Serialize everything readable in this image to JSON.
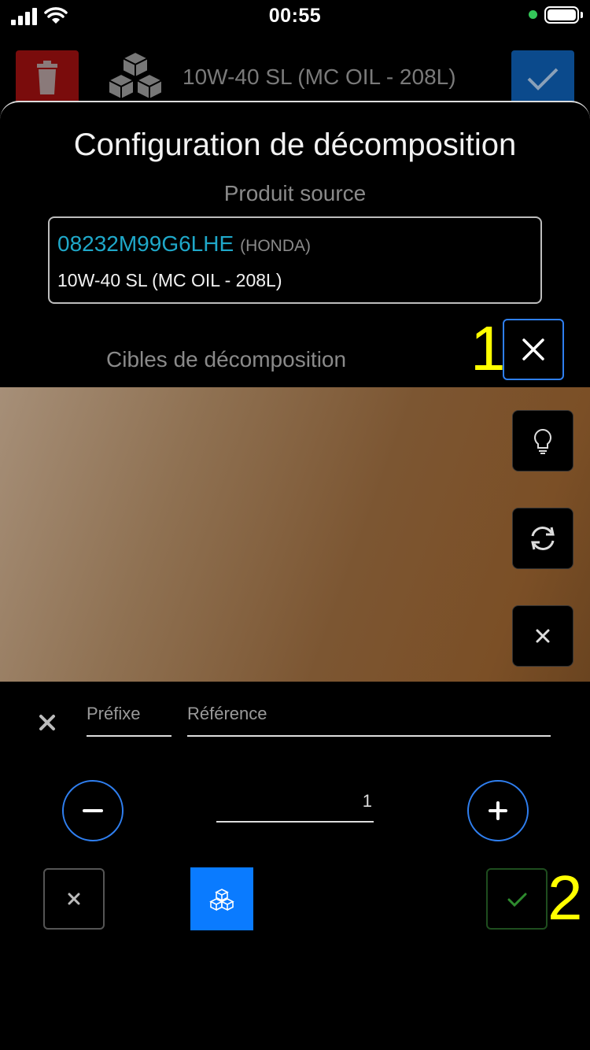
{
  "status_bar": {
    "time": "00:55"
  },
  "background_header": {
    "title": "10W-40 SL (MC OIL - 208L)"
  },
  "modal": {
    "title": "Configuration de décomposition",
    "source_label": "Produit source",
    "source": {
      "reference": "08232M99G6LHE",
      "brand": "(HONDA)",
      "name": "10W-40 SL (MC OIL - 208L)"
    },
    "targets_label": "Cibles de décomposition",
    "fields": {
      "prefix_placeholder": "Préfixe",
      "reference_placeholder": "Référence",
      "quantity": "1"
    }
  },
  "annotations": {
    "one": "1",
    "two": "2"
  },
  "icons": {
    "close": "close-icon",
    "flash": "lightbulb-icon",
    "switch_camera": "refresh-icon",
    "camera_close": "close-icon",
    "minus": "minus-icon",
    "plus": "plus-icon",
    "cancel": "close-icon",
    "decompose": "cubes-icon",
    "confirm": "checkmark-icon"
  },
  "colors": {
    "accent_blue": "#2f7ff0",
    "link_cyan": "#1fa8c9",
    "danger_red": "#7a0c0c",
    "confirm_green": "#2e8b2e",
    "annotation_yellow": "#ffff00"
  }
}
